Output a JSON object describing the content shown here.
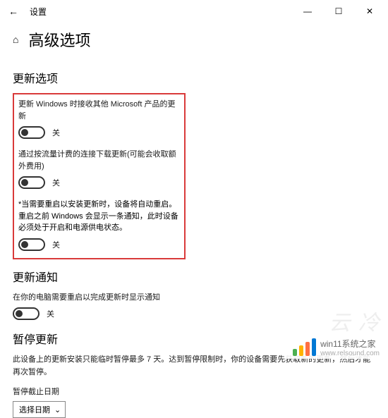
{
  "titlebar": {
    "title": "设置"
  },
  "page": {
    "title": "高级选项"
  },
  "section_update_options": {
    "heading": "更新选项",
    "opt1": {
      "label": "更新 Windows 时接收其他 Microsoft 产品的更新",
      "state": "关"
    },
    "opt2": {
      "label": "通过按流量计费的连接下载更新(可能会收取额外费用)",
      "state": "关"
    },
    "opt3": {
      "label": "*当需要重启以安装更新时，设备将自动重启。重启之前 Windows 会显示一条通知，此时设备必须处于开启和电源供电状态。",
      "state": "关"
    }
  },
  "section_notifications": {
    "heading": "更新通知",
    "opt1": {
      "label": "在你的电脑需要重启以完成更新时显示通知",
      "state": "关"
    }
  },
  "section_pause": {
    "heading": "暂停更新",
    "desc": "此设备上的更新安装只能临时暂停最多 7 天。达到暂停限制时，你的设备需要先获取新的更新，然后才能再次暂停。",
    "date_label": "暂停截止日期",
    "dropdown": "选择日期"
  },
  "watermark": {
    "text": "win11系统之家",
    "url": "www.relsound.com"
  },
  "faded": "云 冷"
}
